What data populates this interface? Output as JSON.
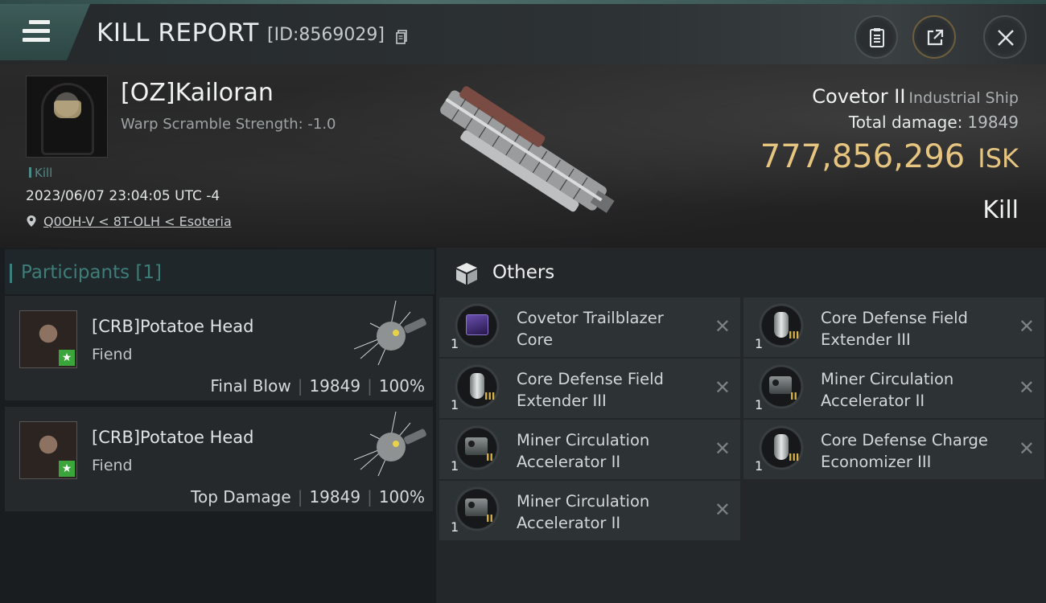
{
  "header": {
    "title": "KILL REPORT",
    "report_id": "[ID:8569029]"
  },
  "victim": {
    "name": "[OZ]Kailoran",
    "warp_scramble": "Warp Scramble Strength: -1.0",
    "tag": "Kill",
    "datetime": "2023/06/07 23:04:05 UTC -4",
    "location": "Q0OH-V < 8T-OLH < Esoteria"
  },
  "ship": {
    "name": "Covetor II",
    "class": "Industrial Ship",
    "total_damage_label": "Total damage:",
    "total_damage": "19849",
    "isk_value": "777,856,296",
    "currency": "ISK",
    "result": "Kill"
  },
  "participants": {
    "label": "Participants [1]",
    "rows": [
      {
        "name": "[CRB]Potatoe Head",
        "ship": "Fiend",
        "role": "Final Blow",
        "damage": "19849",
        "percent": "100%"
      },
      {
        "name": "[CRB]Potatoe Head",
        "ship": "Fiend",
        "role": "Top Damage",
        "damage": "19849",
        "percent": "100%"
      }
    ]
  },
  "others": {
    "label": "Others",
    "items": [
      {
        "qty": "1",
        "name": "Covetor Trailblazer Core",
        "icon": "purple-core-icon"
      },
      {
        "qty": "1",
        "name": "Core Defense Field Extender III",
        "icon": "shield-module-icon",
        "tier": "III"
      },
      {
        "qty": "1",
        "name": "Core Defense Field Extender III",
        "icon": "shield-module-icon",
        "tier": "III"
      },
      {
        "qty": "1",
        "name": "Miner Circulation Accelerator II",
        "icon": "mining-module-icon",
        "tier": "II"
      },
      {
        "qty": "1",
        "name": "Miner Circulation Accelerator II",
        "icon": "mining-module-icon",
        "tier": "II"
      },
      {
        "qty": "1",
        "name": "Core Defense Charge Economizer III",
        "icon": "shield-module-icon",
        "tier": "III"
      },
      {
        "qty": "1",
        "name": "Miner Circulation Accelerator II",
        "icon": "mining-module-icon",
        "tier": "II"
      }
    ]
  },
  "colors": {
    "accent_teal": "#3d7d7a",
    "isk_gold": "#e6c580",
    "tier_gold": "#d9b24a"
  }
}
